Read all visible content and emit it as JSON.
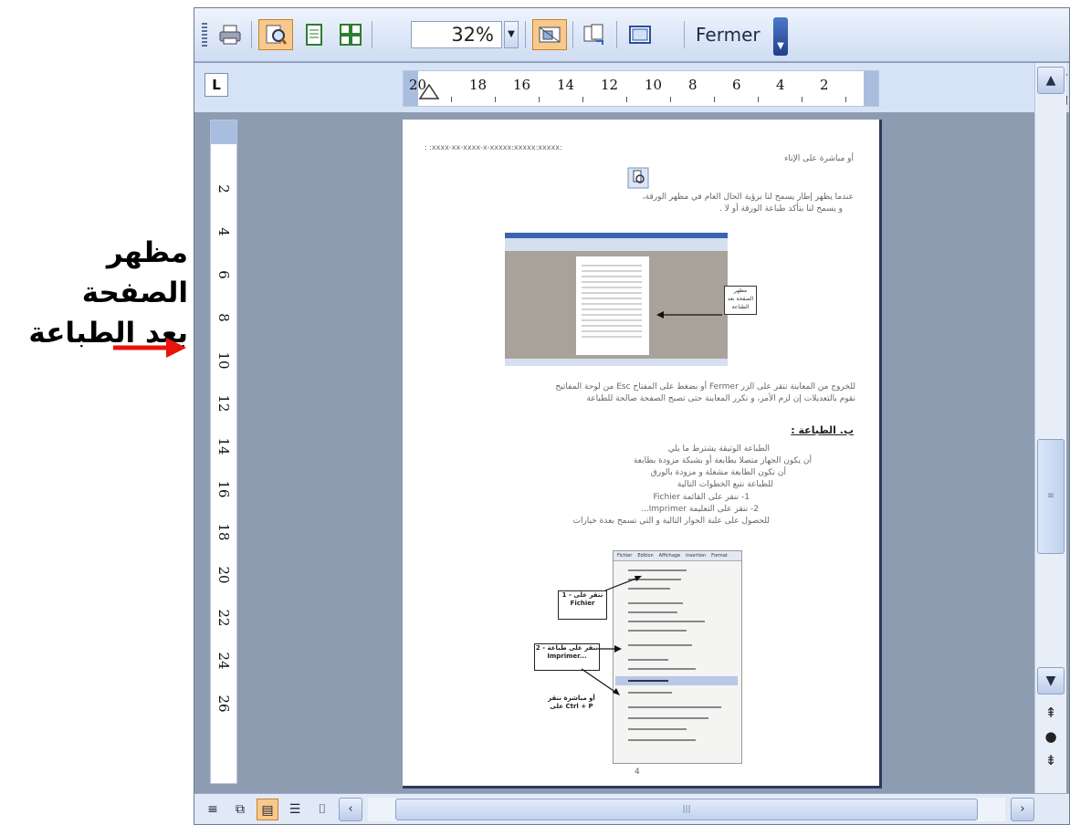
{
  "annotation": {
    "line1": "مظهر الصفحة",
    "line2": "بعد الطباعة",
    "arrow_color": "#e8140c"
  },
  "toolbar": {
    "buttons": [
      "print-icon",
      "magnifier-icon",
      "one-page-icon",
      "multiple-pages-icon",
      "view-ruler-icon",
      "shrink-to-fit-icon",
      "full-screen-icon"
    ],
    "zoom_value": "32%",
    "close_label": "Fermer",
    "active_color": "#f8c98c"
  },
  "ruler": {
    "tab_selector": "L",
    "h_labels": [
      "20",
      "18",
      "16",
      "14",
      "12",
      "10",
      "8",
      "6",
      "4",
      "2"
    ],
    "v_labels": [
      "2",
      "4",
      "6",
      "8",
      "10",
      "12",
      "14",
      "16",
      "18",
      "20",
      "22",
      "24",
      "26"
    ]
  },
  "page": {
    "header": ": :xxxx-xx-xxxx-x-xxxxx:xxxxx:xxxxx:",
    "line1": "أو مباشرة على الإناء",
    "line2": "عندما يظهر إطار يسمح لنا برؤية الحال العام في مظهر الورقة،",
    "line3": "و يسمح لنا بتأكد طباعة الورقة أو لا .",
    "line4": "للخروج من المعاينة نتقر على الزر Fermer أو بضغط على المفتاح Esc من لوحة المفاتيح",
    "line5": "نقوم بالتعديلات إن لزم الأمر، و نكرر المعاينة حتى تصبح الصفحة صالحة للطباعة",
    "section_title": "ب. الطباعة :",
    "line6": "الطباعة الوثيقة يشترط ما يلي",
    "bullet1": "أن يكون الجهاز متصلا بطابعة أو بشبكة مزودة بطابعة",
    "bullet2": "أن تكون الطابعة مشغلة و مزودة بالورق",
    "line7": "للطباعة نتبع الخطوات التالية",
    "step1": "1- ننقر على القائمة Fichier",
    "step2": "2- ننقر على التعليمة Imprimer...",
    "line8": "للحصول على علبة الحوار التالية و التي تسمح بعدة خيارات",
    "note1": "1 - ننقر على Fichier",
    "note2": "2 - ننقر على طباعة Imprimer...",
    "note3": "أو مباشرة ننقر على Ctrl + P",
    "embedded_callout": "مظهر الصفحة بعد الطباعة",
    "menu_items": [
      "Fichier",
      "Edition",
      "Affichage",
      "Insertion",
      "Format"
    ],
    "page_number": "4"
  },
  "scrollbar": {
    "up": "▲",
    "down": "▼",
    "prev_page": "⇞",
    "browse": "●",
    "next_page": "⇟"
  },
  "bottom": {
    "views": [
      "normal-view-icon",
      "web-view-icon",
      "print-layout-icon",
      "outline-view-icon",
      "reading-view-icon"
    ],
    "left_arrow": "‹",
    "right_arrow": "›"
  }
}
